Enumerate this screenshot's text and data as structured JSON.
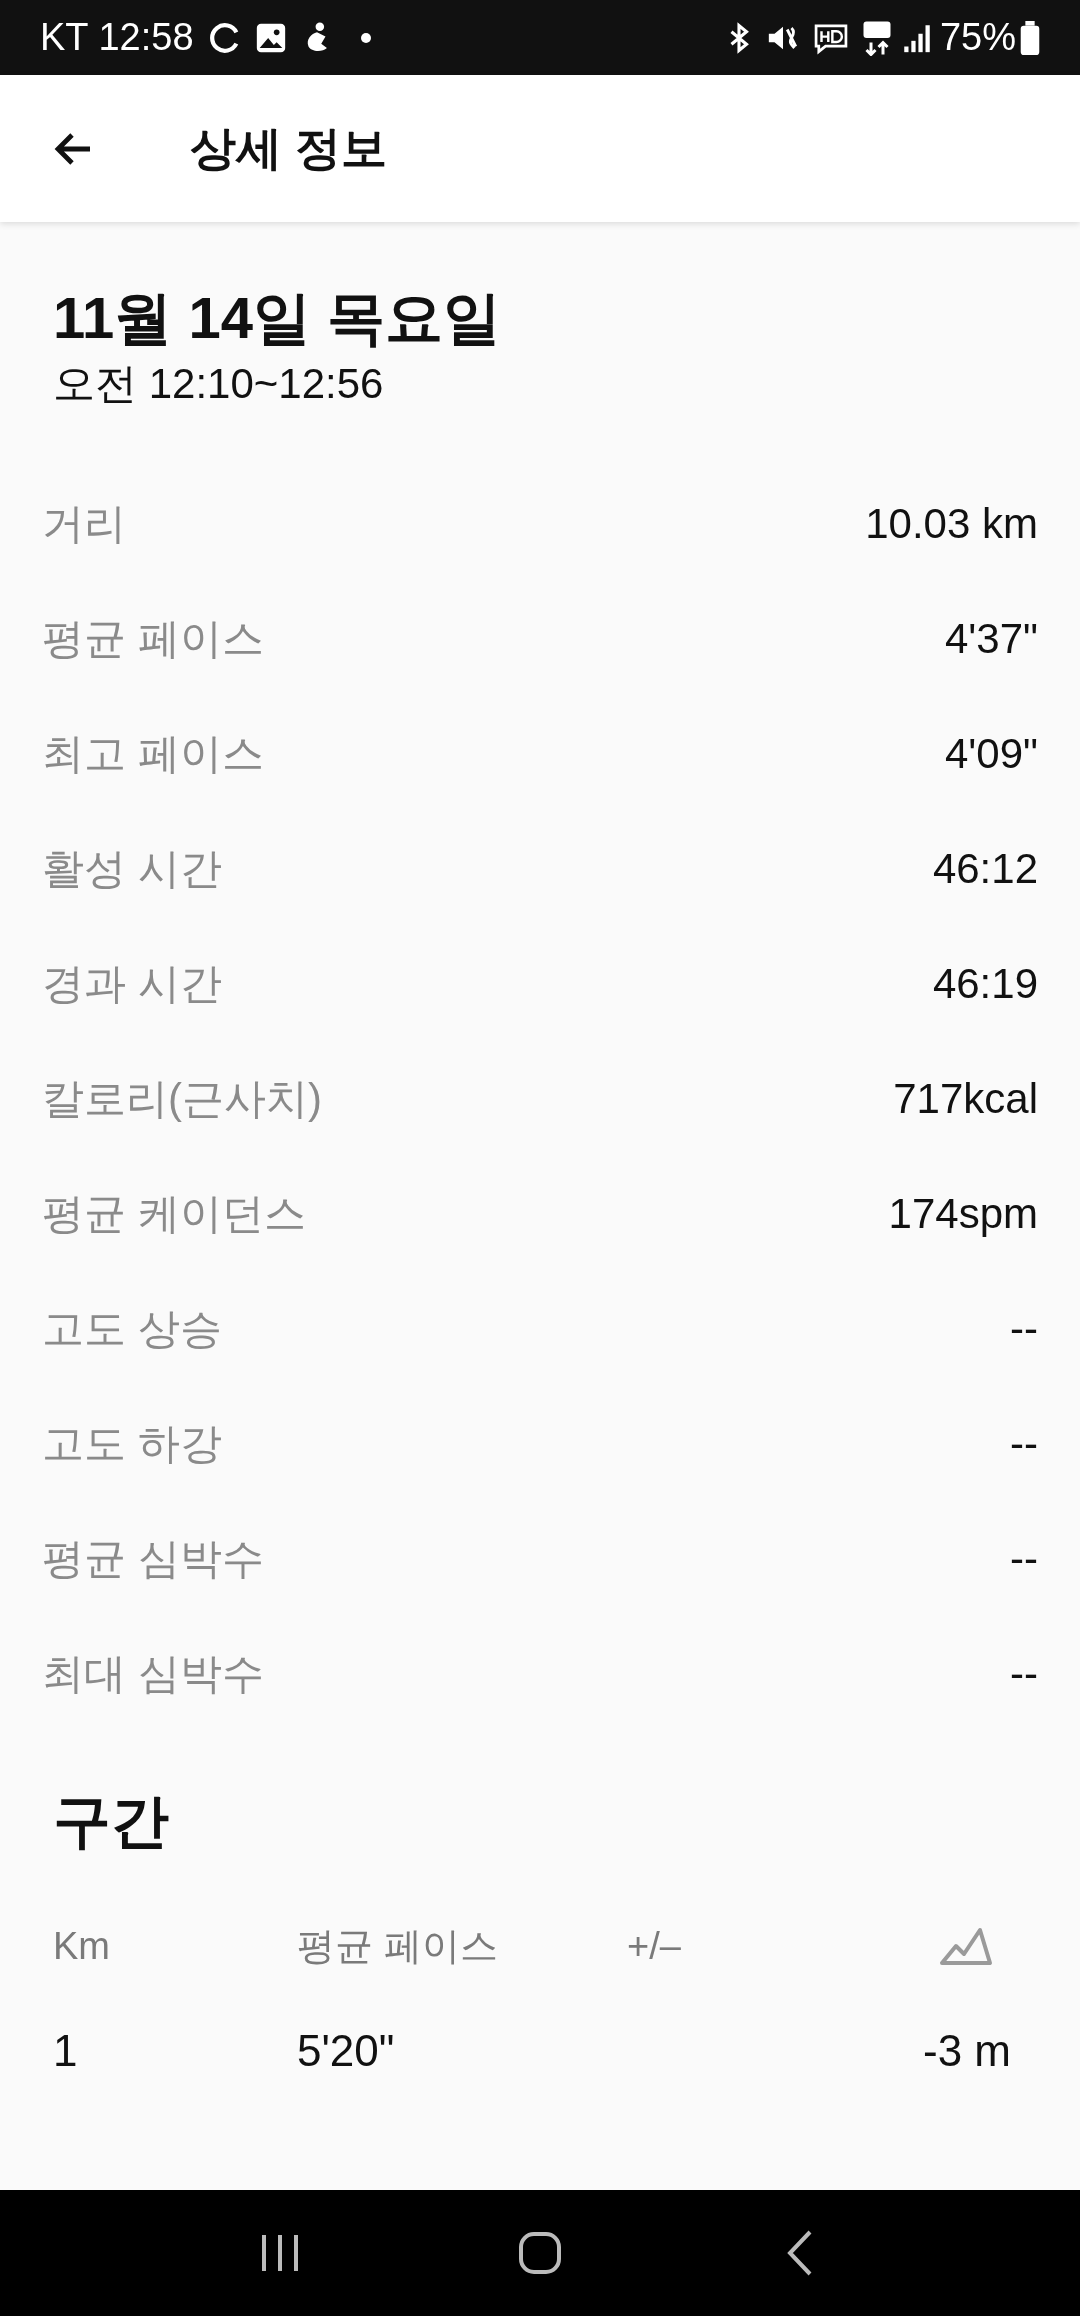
{
  "status_bar": {
    "carrier_time": "KT 12:58",
    "battery": "75%"
  },
  "app_bar": {
    "title": "상세 정보"
  },
  "header": {
    "date": "11월 14일 목요일",
    "time_range": "오전 12:10~12:56"
  },
  "stats": [
    {
      "label": "거리",
      "value": "10.03 km"
    },
    {
      "label": "평균 페이스",
      "value": "4'37\""
    },
    {
      "label": "최고 페이스",
      "value": "4'09\""
    },
    {
      "label": "활성 시간",
      "value": "46:12"
    },
    {
      "label": "경과 시간",
      "value": "46:19"
    },
    {
      "label": "칼로리(근사치)",
      "value": "717kcal"
    },
    {
      "label": "평균 케이던스",
      "value": "174spm"
    },
    {
      "label": "고도 상승",
      "value": "--"
    },
    {
      "label": "고도 하강",
      "value": "--"
    },
    {
      "label": "평균 심박수",
      "value": "--"
    },
    {
      "label": "최대 심박수",
      "value": "--"
    }
  ],
  "splits": {
    "title": "구간",
    "columns": [
      {
        "kind": "text",
        "label": "Km"
      },
      {
        "kind": "text",
        "label": "평균 페이스"
      },
      {
        "kind": "text",
        "label": "+/–"
      },
      {
        "kind": "icon"
      }
    ],
    "rows": [
      {
        "km": "1",
        "pace": "5'20\"",
        "elevation": "-3 m"
      }
    ]
  }
}
